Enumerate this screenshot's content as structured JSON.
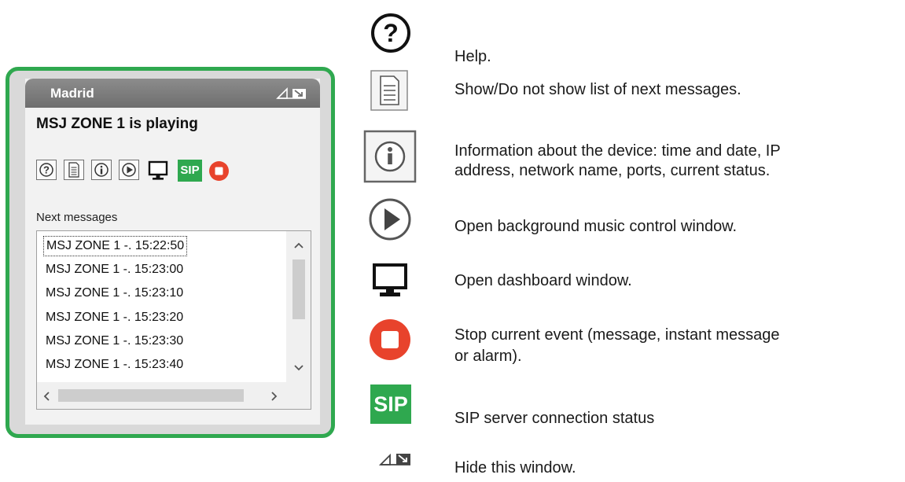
{
  "widget": {
    "title": "Madrid",
    "status_text": "MSJ ZONE 1 is playing",
    "sip_label": "SIP",
    "next_messages_label": "Next messages",
    "next_messages": [
      "MSJ ZONE 1 -. 15:22:50",
      "MSJ ZONE 1 -. 15:23:00",
      "MSJ ZONE 1 -. 15:23:10",
      "MSJ ZONE 1 -. 15:23:20",
      "MSJ ZONE 1 -. 15:23:30",
      "MSJ ZONE 1 -. 15:23:40"
    ],
    "toolbar_icons": [
      "help-icon",
      "document-list-icon",
      "info-icon",
      "play-icon",
      "monitor-icon",
      "sip-status-icon",
      "stop-icon"
    ]
  },
  "legend": {
    "help": "Help.",
    "list": "Show/Do not show list of next messages.",
    "info_line1": "Information about the device: time and date, IP",
    "info_line2": "address, network name, ports, current status.",
    "music": "Open background music control window.",
    "dashboard": "Open dashboard window.",
    "stop_line1": "Stop current event (message, instant message",
    "stop_line2": "or alarm).",
    "sip_label": "SIP",
    "sip": "SIP server connection status",
    "hide": "Hide this window."
  },
  "colors": {
    "frame_green": "#2fa84f",
    "stop_red": "#e8432c",
    "titlebar_gray": "#7a7a7a"
  }
}
